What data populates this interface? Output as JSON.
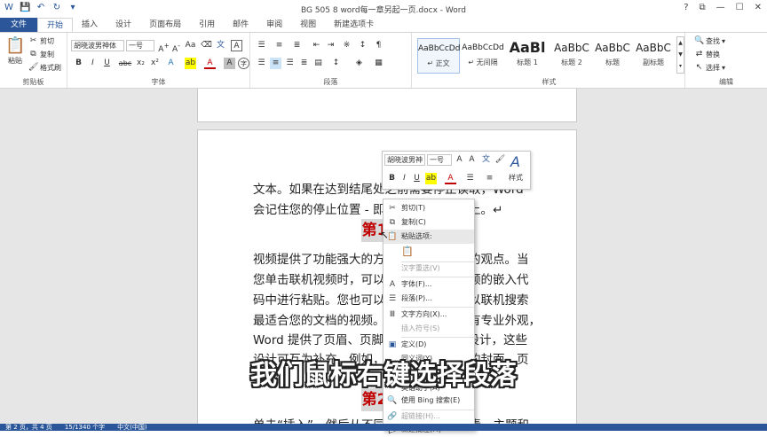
{
  "window": {
    "title": "BG 505 8 word每一章另起一页.docx - Word",
    "help": "?",
    "restore": "⧉",
    "minimize": "—",
    "maximize": "☐",
    "close": "✕"
  },
  "tabs": [
    "文件",
    "开始",
    "插入",
    "设计",
    "页面布局",
    "引用",
    "邮件",
    "审阅",
    "视图",
    "新建选项卡"
  ],
  "ribbon": {
    "clipboard": {
      "label": "剪贴板",
      "paste": "粘贴",
      "cut": "剪切",
      "copy": "复制",
      "format_painter": "格式刷"
    },
    "font": {
      "label": "字体",
      "font_name": "胡晓波男神体",
      "font_size": "一号",
      "bold": "B",
      "italic": "I",
      "underline": "U",
      "strike": "abc",
      "sub": "x₂",
      "sup": "x²",
      "text_a": "A",
      "aa": "Aa"
    },
    "paragraph": {
      "label": "段落"
    },
    "styles": {
      "label": "样式",
      "items": [
        {
          "sample": "AaBbCcDd",
          "name": "↵ 正文"
        },
        {
          "sample": "AaBbCcDd",
          "name": "↵ 无间隔"
        },
        {
          "sample": "AaBl",
          "name": "标题 1"
        },
        {
          "sample": "AaBbC",
          "name": "标题 2"
        },
        {
          "sample": "AaBbC",
          "name": "标题"
        },
        {
          "sample": "AaBbC",
          "name": "副标题"
        }
      ]
    },
    "editing": {
      "label": "编辑",
      "find": "查找",
      "replace": "替换",
      "select": "选择"
    }
  },
  "document": {
    "lines": [
      "文本。如果在达到结尾处之前需要停止读取，Word",
      "会记住您的停止位置 - 即使在另一个设备上。↵",
      "视频提供了功能强大的方法帮助您证明您的观点。当",
      "您单击联机视频时，可以在想要添加的视频的嵌入代",
      "码中进行粘贴。您也可以键入一个关键字以联机搜索",
      "最适合您的文档的视频。为使您的文档具有专业外观，",
      "Word 提供了页眉、页脚、封面和文本框设计，这些",
      "设计可互为补充。例如，您可以添加匹配的封面、页",
      "单击“插入”，然后从不同库中选择所需元素。主题和"
    ],
    "heading1": "第1",
    "heading2": "第2"
  },
  "mini_toolbar": {
    "font_name": "胡晓波男神",
    "font_size": "一号",
    "styles_label": "样式"
  },
  "context_menu": {
    "items": [
      {
        "icon": "cut-icon",
        "label": "剪切(T)",
        "disabled": false
      },
      {
        "icon": "copy-icon",
        "label": "复制(C)",
        "disabled": false
      },
      {
        "icon": "paste-icon",
        "label": "粘贴选项:",
        "disabled": false
      },
      {
        "icon": "",
        "label": "汉字重选(V)",
        "disabled": true
      },
      {
        "icon": "font-icon",
        "label": "字体(F)...",
        "disabled": false
      },
      {
        "icon": "paragraph-icon",
        "label": "段落(P)...",
        "disabled": false
      },
      {
        "icon": "text-direction-icon",
        "label": "文字方向(X)...",
        "disabled": false
      },
      {
        "icon": "",
        "label": "插入符号(S)",
        "disabled": true
      },
      {
        "icon": "define-icon",
        "label": "定义(D)",
        "disabled": false
      },
      {
        "icon": "synonym-icon",
        "label": "同义词(Y)",
        "disabled": false
      },
      {
        "icon": "translate-icon",
        "label": "英语助手(A)",
        "disabled": false
      },
      {
        "icon": "bing-icon",
        "label": "使用 Bing 搜索(E)",
        "disabled": false
      },
      {
        "icon": "hyperlink-icon",
        "label": "超链接(H)...",
        "disabled": true
      },
      {
        "icon": "comment-icon",
        "label": "新建批注(M)",
        "disabled": false
      }
    ]
  },
  "status": {
    "page": "第 2 页，共 4 页",
    "words": "15/1340 个字",
    "lang": "中文(中国)"
  },
  "subtitle": "我们鼠标右键选择段落",
  "colors": {
    "accent": "#2b579a",
    "heading_red": "#c00000"
  }
}
